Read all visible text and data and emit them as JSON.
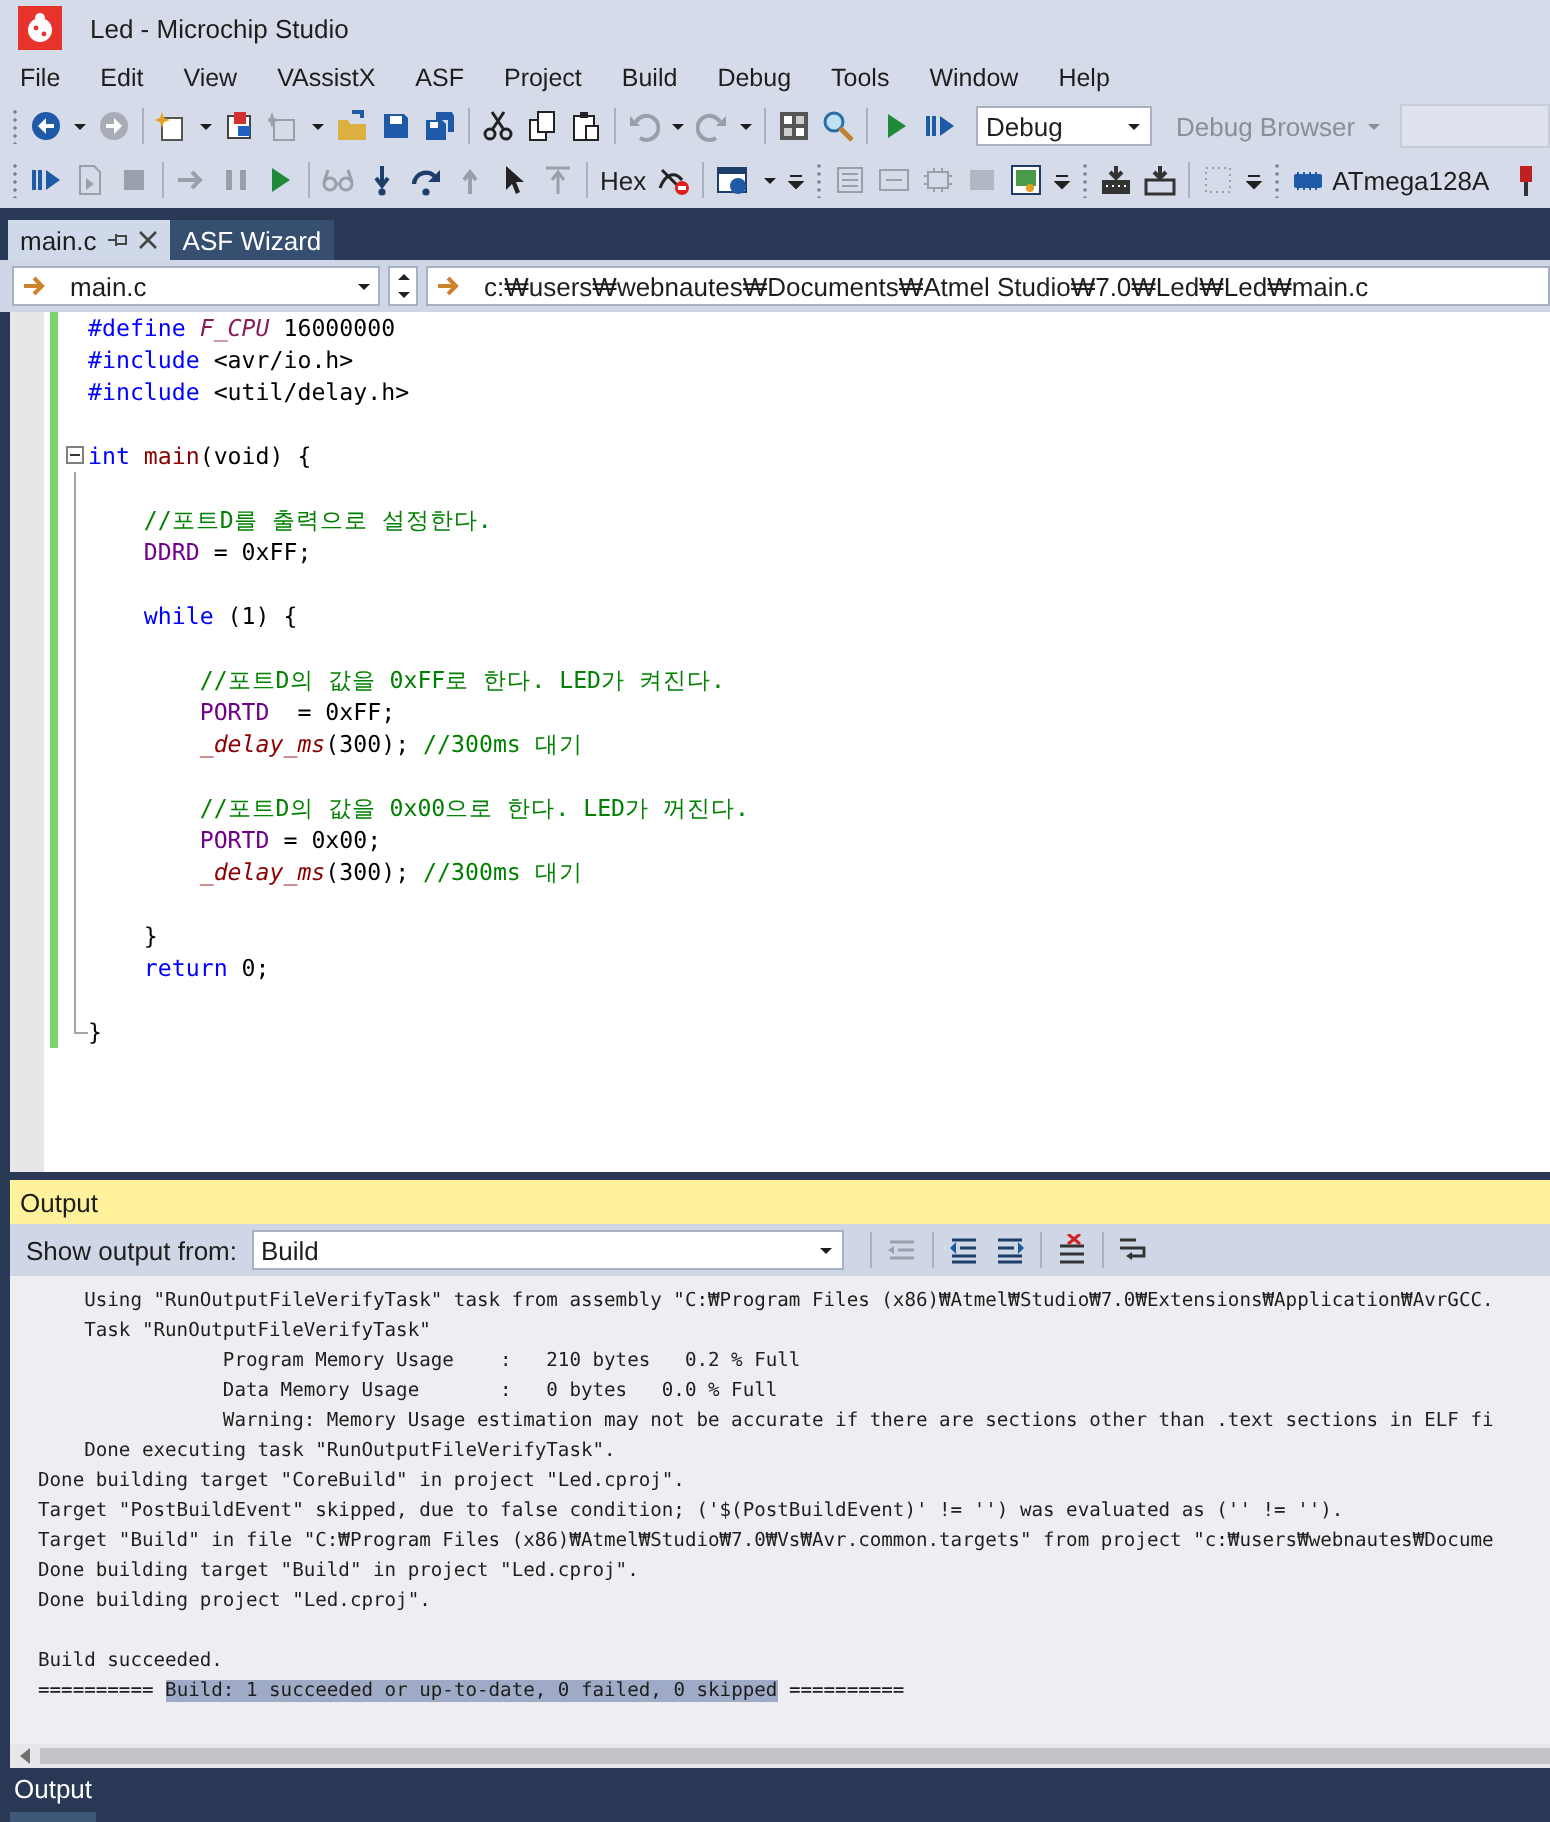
{
  "window": {
    "title": "Led - Microchip Studio"
  },
  "menu": [
    "File",
    "Edit",
    "View",
    "VAssistX",
    "ASF",
    "Project",
    "Build",
    "Debug",
    "Tools",
    "Window",
    "Help"
  ],
  "toolbar": {
    "configuration": {
      "value": "Debug"
    },
    "debug_browser": {
      "label": "Debug Browser",
      "disabled": true
    },
    "hex": "Hex",
    "device": "ATmega128A"
  },
  "tabs": [
    {
      "label": "main.c",
      "selected": true
    },
    {
      "label": "ASF Wizard",
      "selected": false
    }
  ],
  "navigation": {
    "file": "main.c",
    "path": "c:₩users₩webnautes₩Documents₩Atmel Studio₩7.0₩Led₩Led₩main.c"
  },
  "editor": {
    "lines": [
      {
        "foldable": false,
        "tokens": [
          {
            "kind": "preprocessor",
            "text": "#define "
          },
          {
            "kind": "macro",
            "text": "F_CPU"
          },
          {
            "kind": "plain",
            "text": " 16000000"
          }
        ]
      },
      {
        "foldable": false,
        "tokens": [
          {
            "kind": "preprocessor",
            "text": "#include "
          },
          {
            "kind": "plain",
            "text": "<avr/io.h>"
          }
        ]
      },
      {
        "foldable": false,
        "tokens": [
          {
            "kind": "preprocessor",
            "text": "#include "
          },
          {
            "kind": "plain",
            "text": "<util/delay.h>"
          }
        ]
      },
      {
        "foldable": false
      },
      {
        "foldable": true,
        "tokens": [
          {
            "kind": "keyword",
            "text": "int "
          },
          {
            "kind": "function",
            "text": "main"
          },
          {
            "kind": "plain",
            "text": "(void) {"
          }
        ]
      },
      {
        "foldable": false
      },
      {
        "foldable": false,
        "tokens": [
          {
            "kind": "comment",
            "text": "    //포트D를 출력으로 설정한다."
          }
        ]
      },
      {
        "foldable": false,
        "tokens": [
          {
            "kind": "variable",
            "text": "    DDRD"
          },
          {
            "kind": "plain",
            "text": " = 0xFF;"
          }
        ]
      },
      {
        "foldable": false
      },
      {
        "foldable": false,
        "tokens": [
          {
            "kind": "keyword",
            "text": "    while"
          },
          {
            "kind": "plain",
            "text": " (1) {"
          }
        ]
      },
      {
        "foldable": false
      },
      {
        "foldable": false,
        "tokens": [
          {
            "kind": "comment",
            "text": "        //포트D의 값을 0xFF로 한다. LED가 켜진다."
          }
        ]
      },
      {
        "foldable": false,
        "tokens": [
          {
            "kind": "variable",
            "text": "        PORTD"
          },
          {
            "kind": "plain",
            "text": "  = 0xFF;"
          }
        ]
      },
      {
        "foldable": false,
        "tokens": [
          {
            "kind": "call",
            "text": "        _delay_ms"
          },
          {
            "kind": "plain",
            "text": "(300); "
          },
          {
            "kind": "comment",
            "text": "//300ms 대기"
          }
        ]
      },
      {
        "foldable": false
      },
      {
        "foldable": false,
        "tokens": [
          {
            "kind": "comment",
            "text": "        //포트D의 값을 0x00으로 한다. LED가 꺼진다."
          }
        ]
      },
      {
        "foldable": false,
        "tokens": [
          {
            "kind": "variable",
            "text": "        PORTD"
          },
          {
            "kind": "plain",
            "text": " = 0x00;"
          }
        ]
      },
      {
        "foldable": false,
        "tokens": [
          {
            "kind": "call",
            "text": "        _delay_ms"
          },
          {
            "kind": "plain",
            "text": "(300); "
          },
          {
            "kind": "comment",
            "text": "//300ms 대기"
          }
        ]
      },
      {
        "foldable": false
      },
      {
        "foldable": false,
        "tokens": [
          {
            "kind": "plain",
            "text": "    }"
          }
        ]
      },
      {
        "foldable": false,
        "tokens": [
          {
            "kind": "keyword",
            "text": "    return"
          },
          {
            "kind": "plain",
            "text": " 0;"
          }
        ]
      },
      {
        "foldable": false
      },
      {
        "foldable": false,
        "tokens": [
          {
            "kind": "plain",
            "text": "}"
          }
        ]
      }
    ]
  },
  "output": {
    "title": "Output",
    "source_label": "Show output from:",
    "source": "Build",
    "lines": [
      {
        "segments": [
          {
            "text": "    Using \"RunOutputFileVerifyTask\" task from assembly \"C:₩Program Files (x86)₩Atmel₩Studio₩7.0₩Extensions₩Application₩AvrGCC.",
            "selected": false
          }
        ]
      },
      {
        "segments": [
          {
            "text": "    Task \"RunOutputFileVerifyTask\"",
            "selected": false
          }
        ]
      },
      {
        "segments": [
          {
            "text": "                Program Memory Usage    :   210 bytes   0.2 % Full",
            "selected": false
          }
        ]
      },
      {
        "segments": [
          {
            "text": "                Data Memory Usage       :   0 bytes   0.0 % Full",
            "selected": false
          }
        ]
      },
      {
        "segments": [
          {
            "text": "                Warning: Memory Usage estimation may not be accurate if there are sections other than .text sections in ELF fi",
            "selected": false
          }
        ]
      },
      {
        "segments": [
          {
            "text": "    Done executing task \"RunOutputFileVerifyTask\".",
            "selected": false
          }
        ]
      },
      {
        "segments": [
          {
            "text": "Done building target \"CoreBuild\" in project \"Led.cproj\".",
            "selected": false
          }
        ]
      },
      {
        "segments": [
          {
            "text": "Target \"PostBuildEvent\" skipped, due to false condition; ('$(PostBuildEvent)' != '') was evaluated as ('' != '').",
            "selected": false
          }
        ]
      },
      {
        "segments": [
          {
            "text": "Target \"Build\" in file \"C:₩Program Files (x86)₩Atmel₩Studio₩7.0₩Vs₩Avr.common.targets\" from project \"c:₩users₩webnautes₩Docume",
            "selected": false
          }
        ]
      },
      {
        "segments": [
          {
            "text": "Done building target \"Build\" in project \"Led.cproj\".",
            "selected": false
          }
        ]
      },
      {
        "segments": [
          {
            "text": "Done building project \"Led.cproj\".",
            "selected": false
          }
        ]
      },
      {
        "blank_line_before": true,
        "segments": [
          {
            "text": "Build succeeded.",
            "selected": false
          }
        ]
      },
      {
        "segments": [
          {
            "text": "========== ",
            "selected": false
          },
          {
            "text": "Build: 1 succeeded or up-to-date, 0 failed, 0 skipped",
            "selected": true
          },
          {
            "text": " ==========",
            "selected": false
          }
        ]
      }
    ]
  },
  "bottom_tabs": [
    {
      "label": "Output"
    }
  ]
}
